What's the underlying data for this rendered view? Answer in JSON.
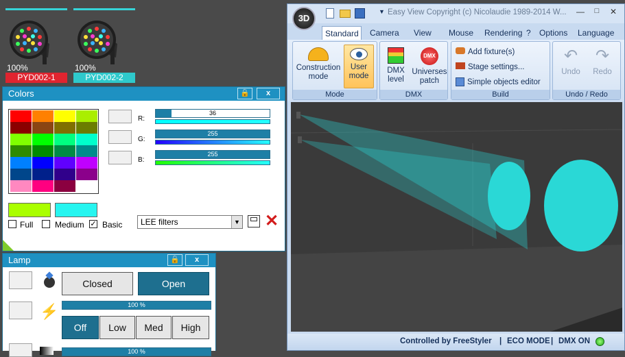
{
  "fixtures": [
    {
      "percent": "100%",
      "name": "PYD002-1",
      "name_color": "#e0242f"
    },
    {
      "percent": "100%",
      "name": "PYD002-2",
      "name_color": "#2ec9cc"
    }
  ],
  "colors_panel": {
    "title": "Colors",
    "swatches": [
      [
        "#ff0000",
        "#ff8000",
        "#ffff00",
        "#aaee00"
      ],
      [
        "#8b0000",
        "#8b4513",
        "#807000",
        "#6b7d00"
      ],
      [
        "#80ff00",
        "#00ff00",
        "#00ff80",
        "#00ffcc"
      ],
      [
        "#2e8b00",
        "#008b00",
        "#008b45",
        "#008b8b"
      ],
      [
        "#0080ff",
        "#0000ff",
        "#6000ff",
        "#c000ff"
      ],
      [
        "#00468b",
        "#00208b",
        "#30008b",
        "#8b008b"
      ],
      [
        "#ff88c0",
        "#ff0080",
        "#8b0040",
        "#ffffff"
      ]
    ],
    "rgb": [
      {
        "label": "R:",
        "value": "36",
        "fraction": 0.14
      },
      {
        "label": "G:",
        "value": "255",
        "fraction": 1
      },
      {
        "label": "B:",
        "value": "255",
        "fraction": 1
      }
    ],
    "current_color": "#aaff00",
    "target_color": "#27f5f0",
    "options": [
      {
        "label": "Full",
        "checked": false
      },
      {
        "label": "Medium",
        "checked": false
      },
      {
        "label": "Basic",
        "checked": true
      }
    ],
    "filter_select": "LEE filters"
  },
  "lamp_panel": {
    "title": "Lamp",
    "shutter": [
      "Closed",
      "Open"
    ],
    "dimmer_value": "100 %",
    "strobe": [
      "Off",
      "Low",
      "Med",
      "High"
    ],
    "partial_value": "100 %"
  },
  "main_window": {
    "title": "Easy View   Copyright (c) Nicolaudie 1989-2014   W...",
    "tabs": [
      "Standard f",
      "Camera",
      "View",
      "Mouse",
      "Rendering",
      "?",
      "Options",
      "Language"
    ],
    "groups": [
      {
        "caption": "Mode",
        "buttons": [
          "Construction mode",
          "User mode"
        ]
      },
      {
        "caption": "DMX",
        "buttons": [
          "DMX level",
          "Universes patch"
        ]
      },
      {
        "caption": "Build",
        "buttons": [
          "Add fixture(s)",
          "Stage settings...",
          "Simple objects editor"
        ]
      },
      {
        "caption": "Undo / Redo",
        "buttons": [
          "Undo",
          "Redo"
        ]
      }
    ],
    "status": [
      "Controlled by FreeStyler",
      "ECO MODE",
      "DMX ON"
    ],
    "beam_color": "#2ad8d6"
  }
}
